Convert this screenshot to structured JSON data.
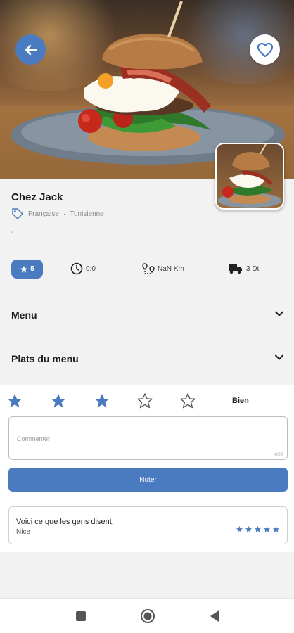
{
  "header": {
    "back_icon": "arrow-left-icon",
    "favorite_icon": "heart-outline-icon",
    "accent_color": "#4a7bc0"
  },
  "restaurant": {
    "name": "Chez Jack",
    "categories": [
      "Française",
      "Tunisienne"
    ],
    "description": "-"
  },
  "stats": {
    "rating": "5",
    "time": "0:0",
    "distance": "NaN Km",
    "delivery_fee": "3  Dt"
  },
  "sections": {
    "menu_label": "Menu",
    "dishes_label": "Plats du menu"
  },
  "review": {
    "selected_stars": 3,
    "total_stars": 5,
    "rating_word": "Bien",
    "comment_placeholder": "Commenter",
    "char_count": "0/20",
    "submit_label": "Noter"
  },
  "testimonials": {
    "heading": "Voici ce que les gens disent:",
    "comment": "Nice",
    "stars": 5
  },
  "nav": {
    "recent_icon": "square-icon",
    "home_icon": "circle-icon",
    "back_icon": "triangle-back-icon"
  }
}
